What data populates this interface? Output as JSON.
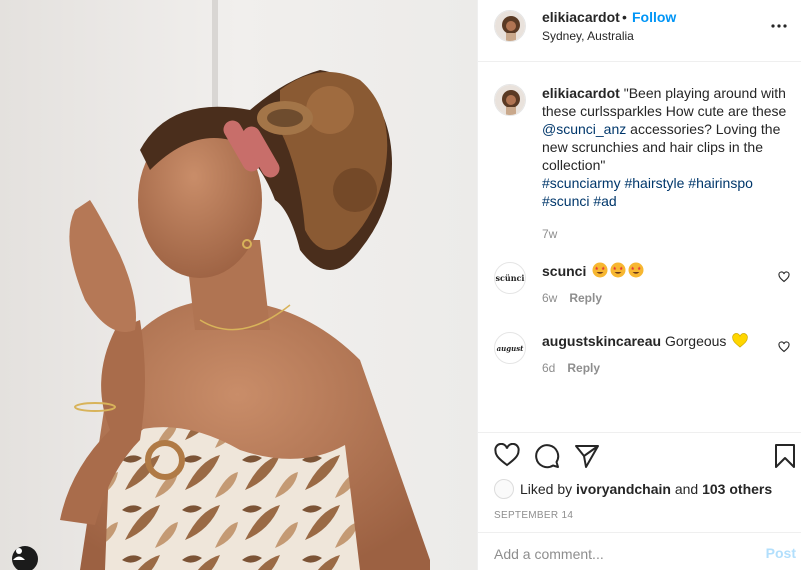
{
  "post": {
    "username": "elikiacardot",
    "dot": "•",
    "follow_label": "Follow",
    "location": "Sydney, Australia",
    "caption": {
      "username": "elikiacardot",
      "text_1": "\"Been playing around with these curlssparkles How cute are these ",
      "mention": "@scunci_anz",
      "text_2": " accessories? Loving the new scrunchies and hair clips in the collection\"",
      "hashtags": [
        "#scunciarmy",
        "#hairstyle",
        "#hairinspo",
        "#scunci",
        "#ad"
      ],
      "time": "7w"
    },
    "comments": [
      {
        "username": "scunci",
        "logo_text": "scünci",
        "text": "",
        "emoji": "star-struck-face-icon",
        "emoji_count": 3,
        "time": "6w",
        "reply_label": "Reply"
      },
      {
        "username": "augustskincareau",
        "logo_text": "august",
        "text": "Gorgeous",
        "emoji": "yellow-heart-icon",
        "emoji_count": 1,
        "time": "6d",
        "reply_label": "Reply"
      }
    ],
    "liked_by": {
      "prefix": "Liked by",
      "user": "ivoryandchain",
      "middle": "and",
      "others": "103 others"
    },
    "date": "SEPTEMBER 14",
    "add_comment": {
      "placeholder": "Add a comment...",
      "post_label": "Post"
    }
  },
  "icons": {
    "more": "more-horizontal-icon",
    "like": "heart-outline-icon",
    "comment": "comment-bubble-icon",
    "share": "paper-plane-icon",
    "save": "bookmark-icon",
    "tag": "user-tag-icon"
  },
  "colors": {
    "link": "#00376b",
    "follow": "#0095f6",
    "muted": "#8e8e8e",
    "post_disabled": "#b2dffc"
  }
}
